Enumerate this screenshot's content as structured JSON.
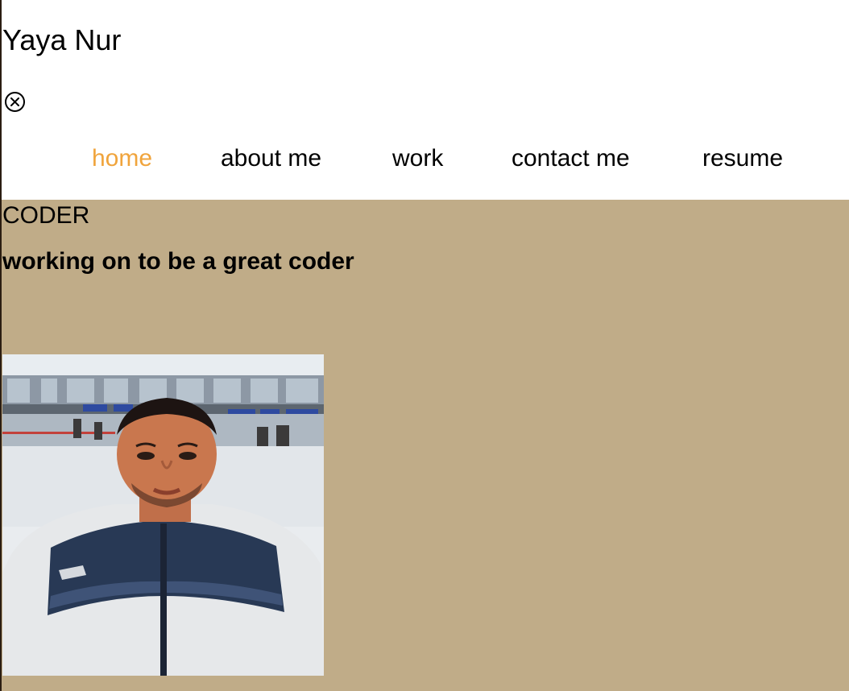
{
  "header": {
    "title": "Yaya Nur",
    "close_icon": "circle-x-icon"
  },
  "nav": {
    "active": "home",
    "items": [
      {
        "label": "home"
      },
      {
        "label": "about me"
      },
      {
        "label": "work"
      },
      {
        "label": "contact me"
      },
      {
        "label": "resume"
      }
    ],
    "active_color": "#f0a43c"
  },
  "hero": {
    "title": "CODER",
    "subtitle": "working on to be a great coder",
    "background_color": "#c0ac88",
    "photo_icon": "profile-photo"
  }
}
